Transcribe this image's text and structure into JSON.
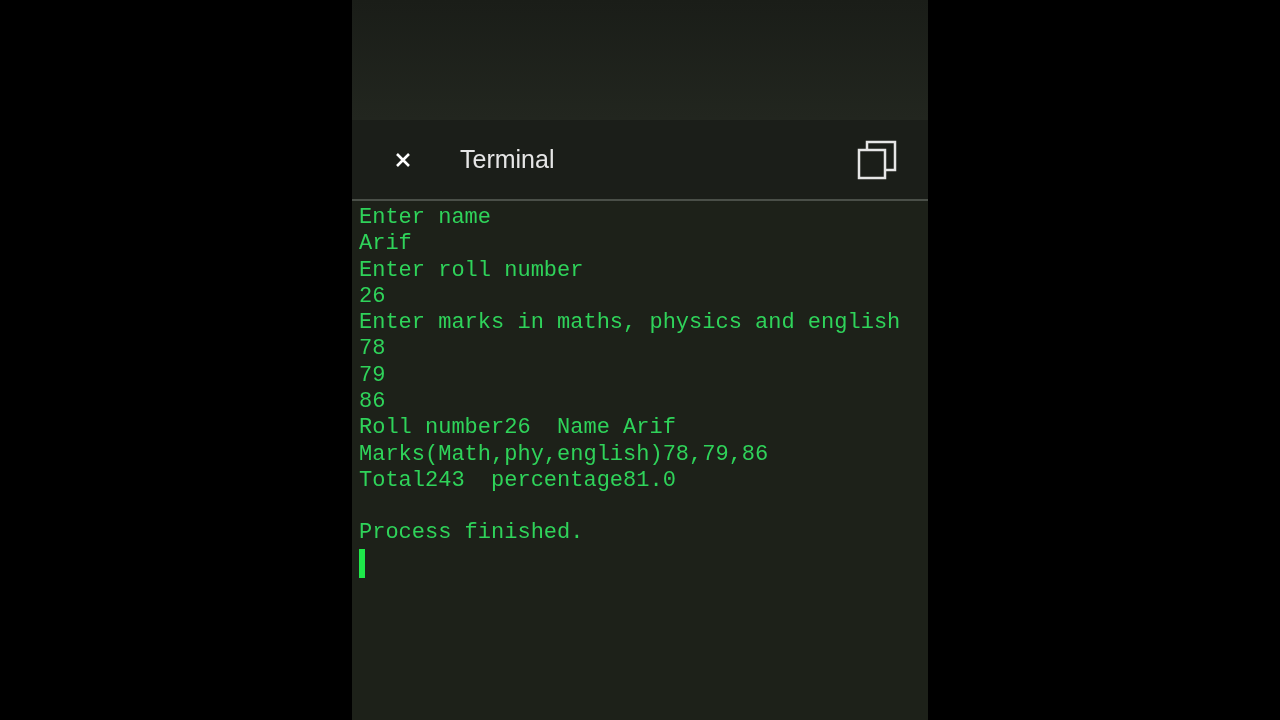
{
  "header": {
    "title": "Terminal"
  },
  "terminal": {
    "lines": [
      "Enter name",
      "Arif",
      "Enter roll number",
      "26",
      "Enter marks in maths, physics and english",
      "78",
      "79",
      "86",
      "Roll number26  Name Arif",
      "Marks(Math,phy,english)78,79,86",
      "Total243  percentage81.0"
    ],
    "status": "Process finished.",
    "cursor": true
  }
}
